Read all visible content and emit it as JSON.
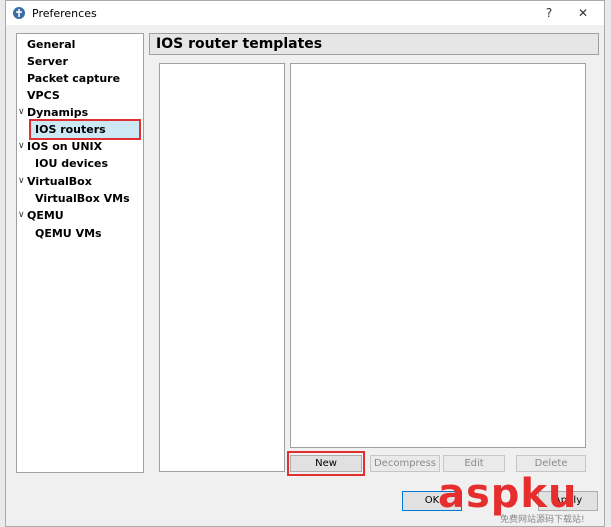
{
  "window": {
    "title": "Preferences",
    "help_label": "?",
    "close_label": "✕"
  },
  "sidebar": {
    "items": [
      {
        "label": "General"
      },
      {
        "label": "Server"
      },
      {
        "label": "Packet capture"
      },
      {
        "label": "VPCS"
      },
      {
        "label": "Dynamips"
      },
      {
        "label": "IOS routers"
      },
      {
        "label": "IOS on UNIX"
      },
      {
        "label": "IOU devices"
      },
      {
        "label": "VirtualBox"
      },
      {
        "label": "VirtualBox VMs"
      },
      {
        "label": "QEMU"
      },
      {
        "label": "QEMU VMs"
      }
    ],
    "selected": "IOS routers",
    "expand_arrow": "∨"
  },
  "main": {
    "title": "IOS router templates",
    "buttons": {
      "new": "New",
      "decompress": "Decompress",
      "edit": "Edit",
      "delete": "Delete"
    }
  },
  "footer": {
    "ok": "OK",
    "apply": "Apply"
  },
  "watermark": {
    "text": "aspku",
    "subtext": "免费网站源码下载站!"
  },
  "colors": {
    "highlight": "#e03030",
    "selection": "#cde8f5",
    "watermark": "#e62e2e"
  }
}
